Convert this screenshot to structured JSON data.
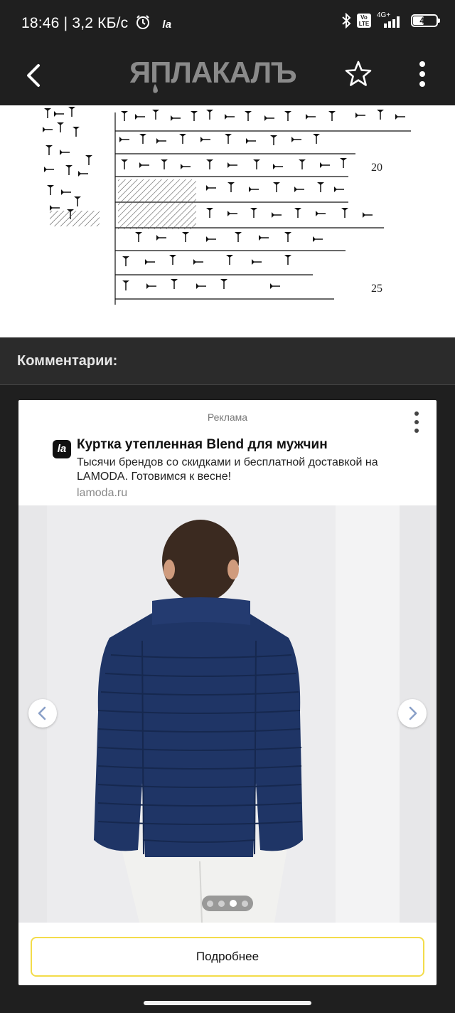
{
  "status_bar": {
    "time": "18:46",
    "speed": "3,2 КБ/с",
    "app_badge": "la",
    "network": "4G+",
    "volte": "Vo LTE",
    "battery": "45"
  },
  "app_bar": {
    "logo_text": "ЯПЛАКАЛЪ"
  },
  "cuneiform": {
    "line_numbers": [
      "20",
      "25"
    ]
  },
  "comments": {
    "title": "Комментарии:"
  },
  "ad": {
    "label": "Реклама",
    "logo_text": "la",
    "title": "Куртка утепленная Blend для мужчин",
    "description": "Тысячи брендов со скидками и бесплатной доставкой на LAMODA. Готовимся к весне!",
    "domain": "lamoda.ru",
    "button_label": "Подробнее",
    "slides_count": 4,
    "active_slide": 3
  },
  "colors": {
    "background": "#1f1f1f",
    "accent_border": "#f3dc4a",
    "jacket": "#1f3566"
  }
}
